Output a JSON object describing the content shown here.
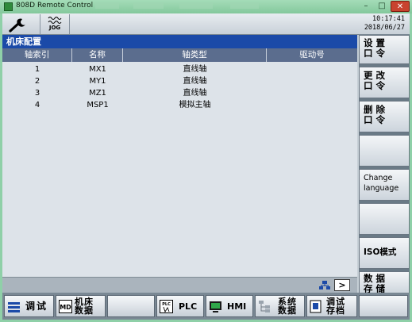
{
  "window": {
    "title": "808D Remote Control",
    "minimize": "–",
    "maximize": "□",
    "close": "✕"
  },
  "header": {
    "mode": "JOG",
    "time": "10:17:41",
    "date": "2018/06/27"
  },
  "panel_title": "机床配置",
  "table": {
    "columns": [
      "轴索引",
      "名称",
      "轴类型",
      "驱动号"
    ],
    "rows": [
      {
        "index": "1",
        "name": "MX1",
        "type": "直线轴",
        "drive": ""
      },
      {
        "index": "2",
        "name": "MY1",
        "type": "直线轴",
        "drive": ""
      },
      {
        "index": "3",
        "name": "MZ1",
        "type": "直线轴",
        "drive": ""
      },
      {
        "index": "4",
        "name": "MSP1",
        "type": "模拟主轴",
        "drive": ""
      }
    ]
  },
  "statusbar": {
    "next_label": ">"
  },
  "vertical_softkeys": {
    "setpw": [
      "设置",
      "口令"
    ],
    "changepw": [
      "更改",
      "口令"
    ],
    "deletepw": [
      "删除",
      "口令"
    ],
    "change_language": [
      "Change",
      "language"
    ],
    "iso_mode": "ISO模式",
    "save_data": [
      "数据",
      "存储"
    ]
  },
  "horizontal_softkeys": {
    "commissioning": "调试",
    "machine_data": [
      "机床",
      "数据"
    ],
    "plc": "PLC",
    "hmi": "HMI",
    "system_data": [
      "系统",
      "数据"
    ],
    "commissioning_archive": [
      "调试",
      "存档"
    ]
  },
  "colors": {
    "title_bar": "#1b4aa8",
    "table_header": "#5b6d8e",
    "window_frame": "#8fd0a8"
  }
}
